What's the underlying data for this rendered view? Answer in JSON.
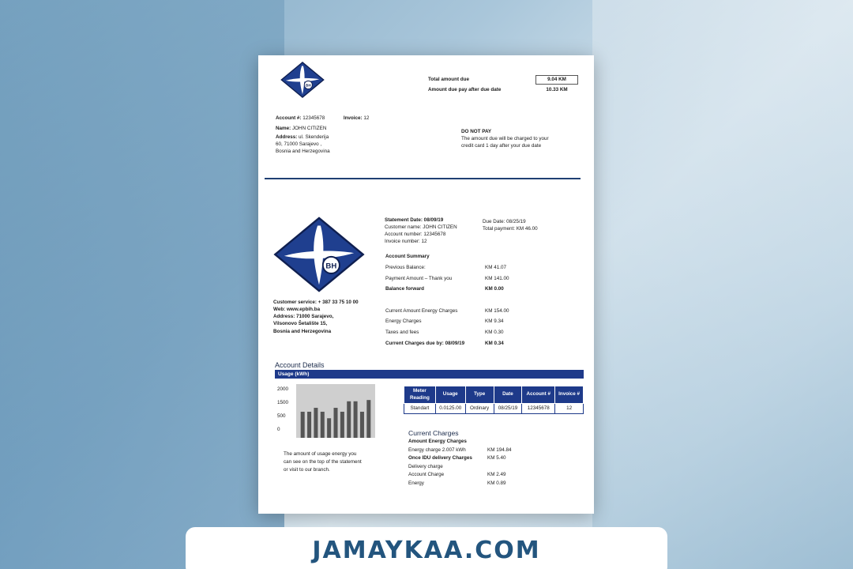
{
  "header": {
    "total_amount_due_label": "Total amount due",
    "total_amount_due_value": "9.04 KM",
    "after_due_label": "Amount due pay after due date",
    "after_due_value": "10.33 KM"
  },
  "account": {
    "account_label": "Account #:",
    "account_value": "12345678",
    "invoice_label": "Invoice:",
    "invoice_value": "12",
    "name_label": "Name:",
    "name_value": "JOHN CITIZEN",
    "address_label": "Address:",
    "address_line1": "ul. Skenderija",
    "address_line2": "60, 71000 Sarajevo ,",
    "address_line3": "Bosnia and Herzegovina"
  },
  "do_not_pay": {
    "title": "DO NOT PAY",
    "line1": "The amount due will be charged to your",
    "line2": "credit card 1 day after your due date"
  },
  "statement": {
    "statement_date": "Statement Date: 08/09/19",
    "customer_name": "Customer name: JOHN CITIZEN",
    "account_number": "Account number: 12345678",
    "invoice_number": "Invoice number: 12",
    "due_date": "Due Date: 08/25/19",
    "total_payment": "Total payment: KM 46.00"
  },
  "logo_text": "BH",
  "summary": {
    "title": "Account Summary",
    "rows_a": [
      {
        "label": "Previous Balance:",
        "value": "KM 41.07"
      },
      {
        "label": "Payment Amount – Thank you",
        "value": "KM 141.00"
      },
      {
        "label": "Balance forward",
        "value": "KM 0.00"
      }
    ],
    "rows_b": [
      {
        "label": "Current Amount Energy Charges",
        "value": "KM 154.00"
      },
      {
        "label": "Energy Charges",
        "value": "KM 9.34"
      },
      {
        "label": "Taxes and fees",
        "value": "KM 0.30"
      },
      {
        "label": "Current Charges due by: 08/09/19",
        "value": "KM 0.34"
      }
    ]
  },
  "customer_service": {
    "phone": "Customer service: + 387 33 75 10 00",
    "web": "Web: www.epbih.ba",
    "address1": "Address: 71000 Sarajevo,",
    "address2": "Vilsonovo  Šetalište 15,",
    "address3": "Bosnia and Herzegovina"
  },
  "account_details": {
    "title": "Account Details",
    "usage_bar": "Usage (kWh)"
  },
  "chart_data": {
    "type": "bar",
    "y_ticks": [
      "2000",
      "1500",
      "500",
      "0"
    ],
    "values": [
      1000,
      1000,
      1150,
      1000,
      750,
      1150,
      1000,
      1400,
      1400,
      1000,
      1450
    ],
    "ylim": [
      0,
      2000
    ]
  },
  "usage_note": {
    "line1": "The amount of usage energy you",
    "line2": "can see on the top of the statement",
    "line3": "or visit to our branch."
  },
  "meter_table": {
    "headers": [
      "Meter Reading",
      "Usage",
      "Type",
      "Date",
      "Account #",
      "Invoice #"
    ],
    "rows": [
      [
        "Standart",
        "0.0125.00",
        "Ordinary",
        "08/25/19",
        "12345678",
        "12"
      ]
    ]
  },
  "current_charges": {
    "title": "Current Charges",
    "subtitle": "Amount Energy Charges",
    "rows": [
      {
        "label": "Energy charge 2.007 kWh",
        "value": "KM 194.84",
        "bold": false
      },
      {
        "label": "Once IDU delivery Charges",
        "value": "KM 5.40",
        "bold": true
      },
      {
        "label": "Delivery charge",
        "value": "",
        "bold": false
      },
      {
        "label": "Account Charge",
        "value": "KM 2.49",
        "bold": false
      },
      {
        "label": "Energy",
        "value": "KM  0.89",
        "bold": false
      }
    ]
  },
  "banner": {
    "text": "JAMAYKAA.COM"
  },
  "colors": {
    "brand_blue": "#1e3a8a",
    "banner_text": "#23557e"
  }
}
